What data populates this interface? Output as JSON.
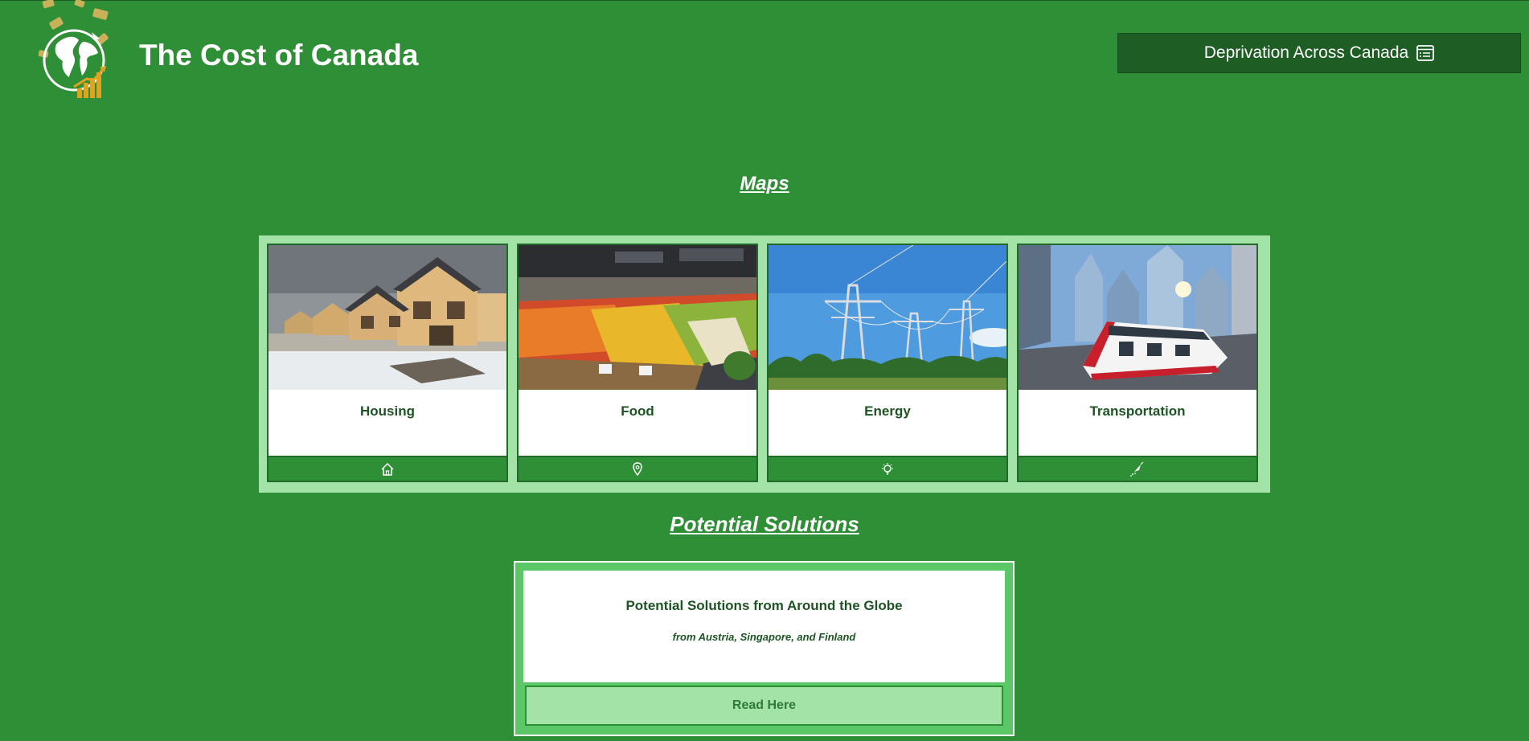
{
  "header": {
    "site_title": "The Cost of Canada",
    "nav_button_label": "Deprivation Across Canada",
    "nav_button_icon": "list-icon"
  },
  "maps": {
    "heading": "Maps",
    "cards": [
      {
        "title": "Housing",
        "icon": "home-icon",
        "image": "houses-under-construction-photo"
      },
      {
        "title": "Food",
        "icon": "location-pin-icon",
        "image": "grocery-produce-photo"
      },
      {
        "title": "Energy",
        "icon": "lightbulb-icon",
        "image": "power-lines-photo"
      },
      {
        "title": "Transportation",
        "icon": "transit-icon",
        "image": "streetcar-city-photo"
      }
    ]
  },
  "solutions": {
    "heading": "Potential Solutions",
    "card_title": "Potential Solutions from Around the Globe",
    "card_subtitle": "from Austria, Singapore, and Finland",
    "button_label": "Read Here"
  },
  "colors": {
    "page_background": "#2f8f36",
    "dark_green": "#1e5e24",
    "light_green": "#a3e3a8",
    "medium_green": "#5cc766",
    "text_dark_green": "#1d5423",
    "logo_gold": "#e0a21f"
  }
}
